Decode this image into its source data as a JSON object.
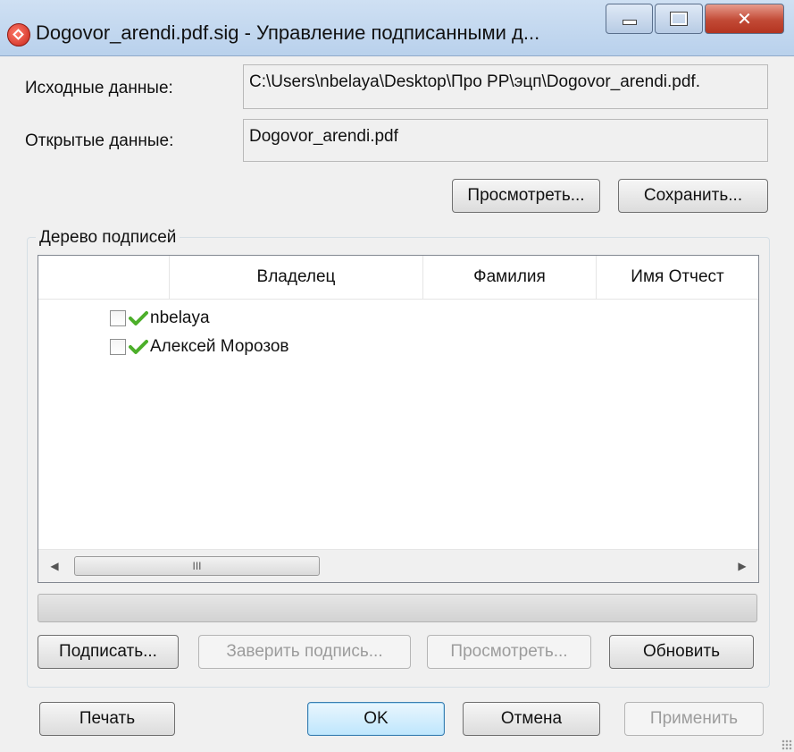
{
  "window": {
    "title": "Dogovor_arendi.pdf.sig - Управление подписанными д..."
  },
  "fields": {
    "source_label": "Исходные данные:",
    "source_value": "C:\\Users\\nbelaya\\Desktop\\Про РР\\эцп\\Dogovor_arendi.pdf.",
    "open_label": "Открытые данные:",
    "open_value": "Dogovor_arendi.pdf"
  },
  "top_buttons": {
    "view": "Просмотреть...",
    "save": "Сохранить..."
  },
  "signature_tree": {
    "group_title": "Дерево подписей",
    "columns": [
      "Владелец",
      "Фамилия",
      "Имя Отчест"
    ],
    "rows": [
      {
        "label": "nbelaya"
      },
      {
        "label": "Алексей Морозов"
      }
    ],
    "scroll_thumb_glyph": "III"
  },
  "tree_buttons": {
    "sign": "Подписать...",
    "certify": "Заверить подпись...",
    "view": "Просмотреть...",
    "refresh": "Обновить"
  },
  "bottom_buttons": {
    "print": "Печать",
    "ok": "OK",
    "cancel": "Отмена",
    "apply": "Применить"
  }
}
